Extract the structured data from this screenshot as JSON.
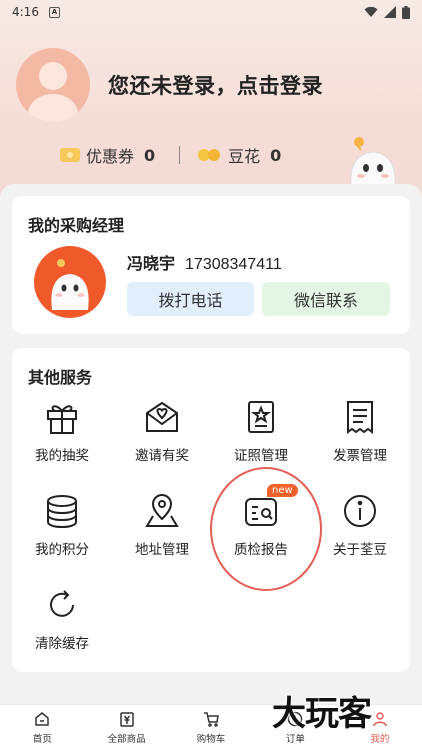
{
  "status_bar": {
    "time": "4:16",
    "badge": "A"
  },
  "profile": {
    "login_prompt": "您还未登录，点击登录"
  },
  "stats": {
    "coupon_label": "优惠券",
    "coupon_count": "0",
    "bean_label": "豆花",
    "bean_count": "0"
  },
  "manager_card": {
    "title": "我的采购经理",
    "name": "冯晓宇",
    "phone": "17308347411",
    "call_button": "拨打电话",
    "wechat_button": "微信联系"
  },
  "services": {
    "title": "其他服务",
    "items": [
      {
        "label": "我的抽奖",
        "icon": "gift-icon"
      },
      {
        "label": "邀请有奖",
        "icon": "envelope-heart-icon"
      },
      {
        "label": "证照管理",
        "icon": "certificate-icon"
      },
      {
        "label": "发票管理",
        "icon": "invoice-icon"
      },
      {
        "label": "我的积分",
        "icon": "coins-stack-icon"
      },
      {
        "label": "地址管理",
        "icon": "location-pin-icon"
      },
      {
        "label": "质检报告",
        "icon": "report-search-icon",
        "badge": "new"
      },
      {
        "label": "关于荃豆",
        "icon": "info-circle-icon"
      },
      {
        "label": "清除缓存",
        "icon": "refresh-icon"
      }
    ]
  },
  "tabbar": {
    "items": [
      {
        "label": "首页",
        "icon": "home-icon"
      },
      {
        "label": "全部商品",
        "icon": "yen-bag-icon"
      },
      {
        "label": "购物车",
        "icon": "cart-icon"
      },
      {
        "label": "订单",
        "icon": "clock-icon"
      },
      {
        "label": "我的",
        "icon": "profile-icon",
        "active": true
      }
    ]
  },
  "watermark": "大玩客",
  "colors": {
    "accent": "#e35d54",
    "brand_orange": "#f05a2b",
    "call_bg": "#e1eefb",
    "wechat_bg": "#e3f5e3"
  }
}
